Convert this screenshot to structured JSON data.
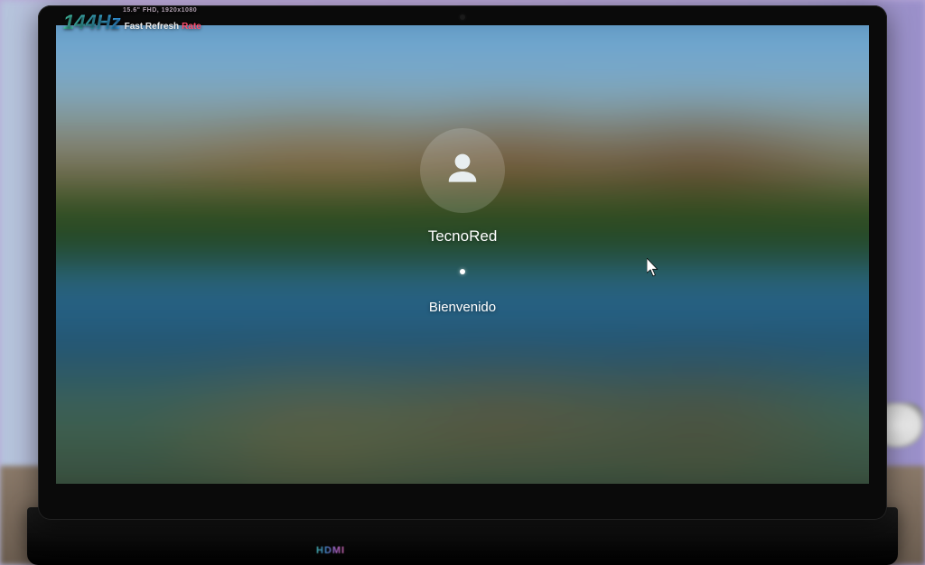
{
  "badge": {
    "hz": "144Hz",
    "line1_a": "Fast Refresh",
    "line1_b": "Rate",
    "tiny": "15.6\" FHD, 1920x1080"
  },
  "login": {
    "username": "TecnoRed",
    "welcome": "Bienvenido",
    "avatar_icon": "user-icon"
  },
  "ports": {
    "hdmi": "HDMI"
  }
}
